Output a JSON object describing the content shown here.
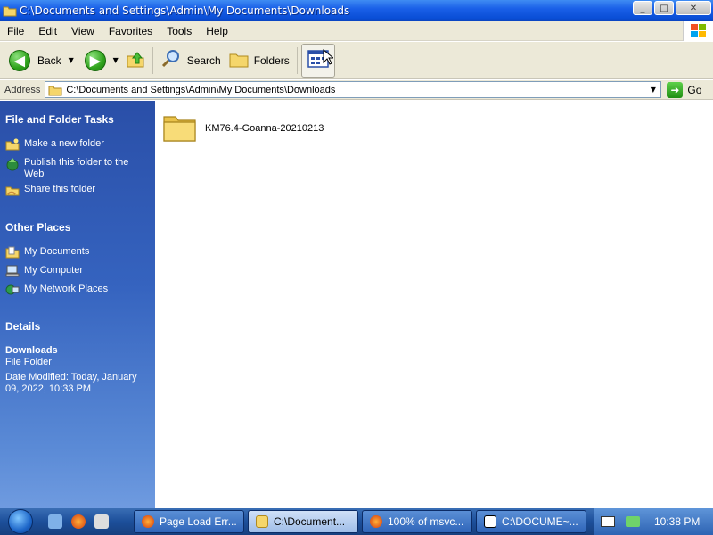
{
  "window": {
    "title": "C:\\Documents and Settings\\Admin\\My Documents\\Downloads",
    "controls": [
      "minimize",
      "maximize",
      "close"
    ]
  },
  "menu": [
    "File",
    "Edit",
    "View",
    "Favorites",
    "Tools",
    "Help"
  ],
  "toolbar": {
    "back_label": "Back",
    "search_label": "Search",
    "folders_label": "Folders"
  },
  "address": {
    "label": "Address",
    "value": "C:\\Documents and Settings\\Admin\\My Documents\\Downloads",
    "go_label": "Go"
  },
  "taskpane": {
    "file_tasks": {
      "title": "File and Folder Tasks",
      "items": [
        "Make a new folder",
        "Publish this folder to the Web",
        "Share this folder"
      ]
    },
    "other_places": {
      "title": "Other Places",
      "items": [
        "My Documents",
        "My Computer",
        "My Network Places"
      ]
    },
    "details": {
      "title": "Details",
      "name": "Downloads",
      "type": "File Folder",
      "modified": "Date Modified: Today, January 09, 2022, 10:33 PM"
    }
  },
  "files": [
    {
      "name": "KM76.4-Goanna-20210213",
      "icon": "folder-icon"
    }
  ],
  "taskbar": {
    "tasks": [
      {
        "label": "Page Load Err...",
        "active": false
      },
      {
        "label": "C:\\Document...",
        "active": true
      },
      {
        "label": "100% of msvc...",
        "active": false
      },
      {
        "label": "C:\\DOCUME~...",
        "active": false
      }
    ],
    "clock": "10:38 PM"
  },
  "colors": {
    "titlebar": "#0a4ed6",
    "taskpane": "#3563bf",
    "chrome": "#ece9d8",
    "taskbar": "#1c4f9a"
  }
}
